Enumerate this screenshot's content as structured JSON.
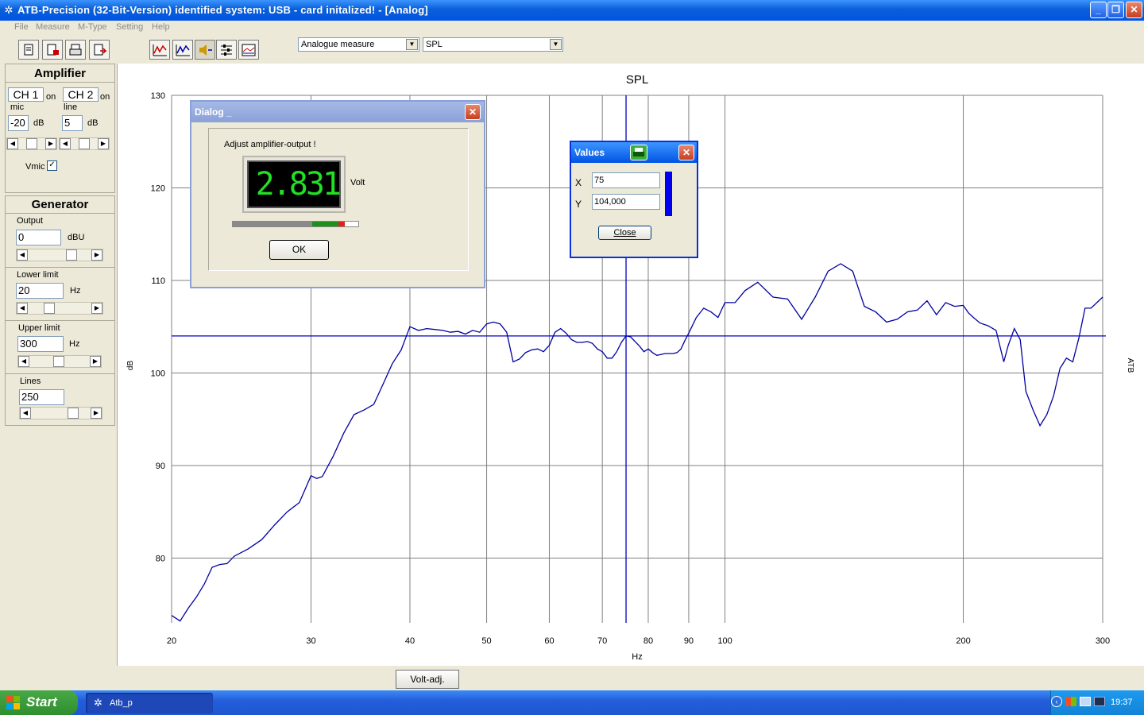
{
  "window": {
    "title": "ATB-Precision  (32-Bit-Version)  identified system: USB - card  initalized! - [Analog]",
    "minimize": "_",
    "restore": "❐",
    "close": "✕"
  },
  "menu": [
    "File",
    "Measure",
    "M-Type",
    "Setting",
    "Help"
  ],
  "toolbar": {
    "mode_combo": "Analogue measure",
    "type_combo": "SPL"
  },
  "amplifier": {
    "title": "Amplifier",
    "ch1_label": "CH 1",
    "ch1_on": "on",
    "ch1_sub": "mic",
    "ch1_value": "-20",
    "ch1_unit": "dB",
    "ch2_label": "CH 2",
    "ch2_on": "on",
    "ch2_sub": "line",
    "ch2_value": "5",
    "ch2_unit": "dB",
    "vmic_label": "Vmic",
    "vmic_checked": "✓"
  },
  "generator": {
    "title": "Generator",
    "output_label": "Output",
    "output_value": "0",
    "output_unit": "dBU",
    "lower_label": "Lower limit",
    "lower_value": "20",
    "lower_unit": "Hz",
    "upper_label": "Upper limit",
    "upper_value": "300",
    "upper_unit": "Hz",
    "lines_label": "Lines",
    "lines_value": "250"
  },
  "dialog": {
    "title": "Dialog _",
    "close": "✕",
    "message": "Adjust amplifier-output !",
    "reading": "2.831",
    "reading_unit": "Volt",
    "level_gray": 0.63,
    "level_green": 0.21,
    "level_red": 0.05,
    "ok_label": "OK"
  },
  "values": {
    "title": "Values",
    "close": "✕",
    "x_label": "X",
    "x_value": "75",
    "y_label": "Y",
    "y_value": "104,000",
    "close_label": "Close"
  },
  "volt_adj_label": "Volt-adj.",
  "taskbar": {
    "start_label": "Start",
    "task_label": "Atb_p",
    "clock": "19:37"
  },
  "chart_data": {
    "type": "line",
    "title": "SPL",
    "xlabel": "Hz",
    "ylabel": "dB",
    "right_label": "ATB",
    "xscale": "log",
    "xlim": [
      20,
      300
    ],
    "ylim": [
      73,
      130
    ],
    "xticks": [
      20,
      30,
      40,
      50,
      60,
      70,
      80,
      90,
      100,
      200,
      300
    ],
    "xtick_labels": [
      "20",
      "30",
      "40",
      "50",
      "60",
      "70",
      "80",
      "90",
      "100",
      "200",
      "300"
    ],
    "yticks": [
      80,
      90,
      100,
      110,
      120,
      130
    ],
    "ytick_labels": [
      "80",
      "90",
      "100",
      "110",
      "120",
      "130"
    ],
    "grid": true,
    "color": "#0000a0",
    "cursor": {
      "x": 75,
      "y": 104.0
    },
    "series": [
      {
        "x": [
          20,
          20.5,
          21,
          21.5,
          22,
          22.5,
          23,
          23.5,
          24,
          25,
          26,
          27,
          28,
          29,
          30,
          30.5,
          31,
          32,
          33,
          34,
          35,
          36,
          37,
          38,
          39,
          40,
          41,
          42,
          43,
          44,
          45,
          46,
          47,
          48,
          49,
          50,
          51,
          52,
          53,
          54,
          55,
          56,
          57,
          58,
          59,
          60,
          61,
          62,
          63,
          64,
          65,
          66,
          67,
          68,
          69,
          70,
          71,
          72,
          73,
          74,
          75,
          76,
          77,
          78,
          79,
          80,
          81,
          82,
          83,
          84,
          85,
          86,
          87,
          88,
          89,
          90,
          92,
          94,
          96,
          98,
          100,
          103,
          106,
          110,
          115,
          120,
          125,
          130,
          135,
          140,
          145,
          150,
          155,
          160,
          165,
          170,
          175,
          180,
          185,
          190,
          195,
          200,
          203,
          206,
          210,
          215,
          220,
          225,
          228,
          232,
          236,
          240,
          245,
          250,
          255,
          260,
          265,
          270,
          275,
          280,
          285,
          290,
          295,
          300
        ],
        "y": [
          73.8,
          73.2,
          74.6,
          75.8,
          77.2,
          79.0,
          79.3,
          79.4,
          80.2,
          81.0,
          82.0,
          83.6,
          85.0,
          86.0,
          88.9,
          88.6,
          88.8,
          91.0,
          93.5,
          95.5,
          96.0,
          96.6,
          98.8,
          101.0,
          102.5,
          105.0,
          104.6,
          104.8,
          104.7,
          104.6,
          104.4,
          104.5,
          104.2,
          104.6,
          104.4,
          105.3,
          105.5,
          105.3,
          104.4,
          101.2,
          101.5,
          102.2,
          102.5,
          102.6,
          102.3,
          103.0,
          104.4,
          104.8,
          104.3,
          103.6,
          103.3,
          103.3,
          103.4,
          103.2,
          102.6,
          102.3,
          101.6,
          101.6,
          102.3,
          103.3,
          104.0,
          103.9,
          103.4,
          102.9,
          102.3,
          102.6,
          102.2,
          101.9,
          102.0,
          102.1,
          102.1,
          102.1,
          102.2,
          102.6,
          103.5,
          104.3,
          106.0,
          107.0,
          106.6,
          106.0,
          107.6,
          107.6,
          108.9,
          109.8,
          108.2,
          108.0,
          105.8,
          108.2,
          111.0,
          111.8,
          111.0,
          107.2,
          106.6,
          105.5,
          105.8,
          106.6,
          106.8,
          107.8,
          106.3,
          107.6,
          107.2,
          107.3,
          106.5,
          106.0,
          105.4,
          105.1,
          104.6,
          101.2,
          103.0,
          104.8,
          103.6,
          98.0,
          96.0,
          94.3,
          95.5,
          97.5,
          100.5,
          101.6,
          101.2,
          103.8,
          107.0,
          107.0,
          107.6,
          108.2
        ]
      }
    ]
  }
}
